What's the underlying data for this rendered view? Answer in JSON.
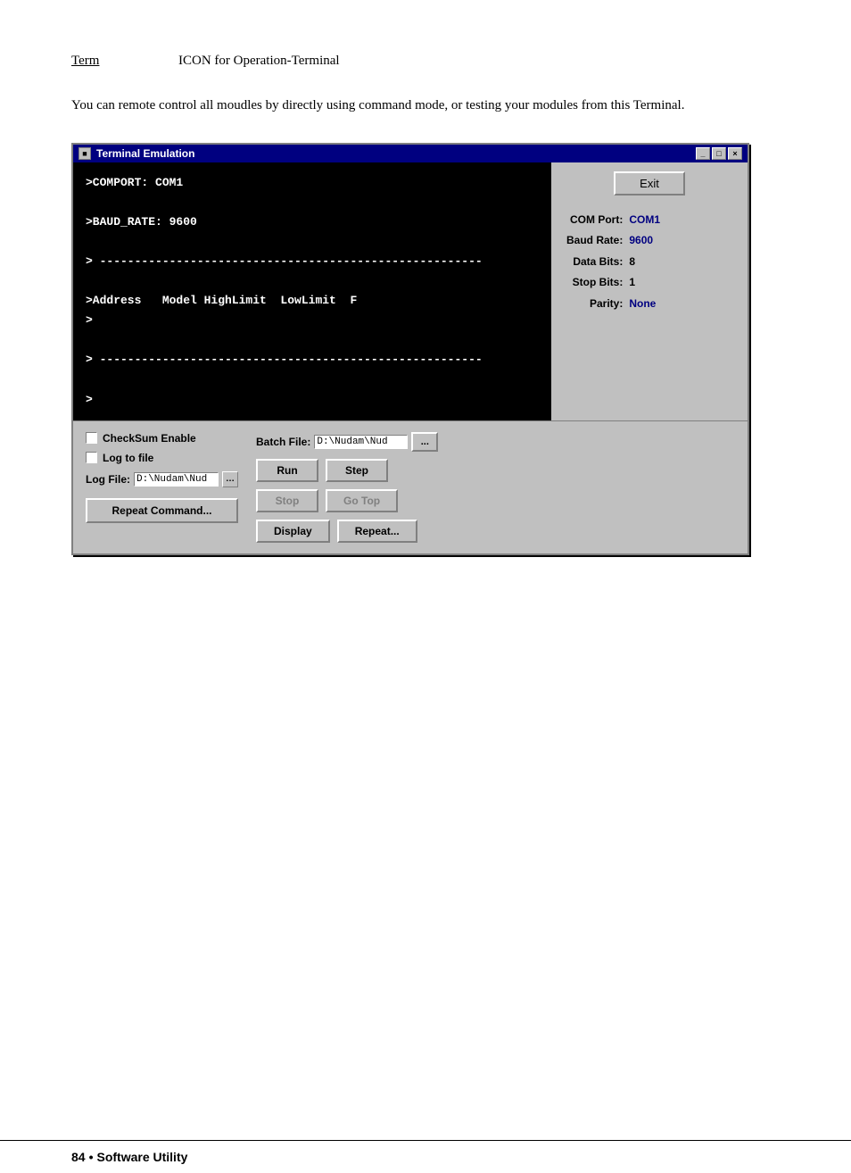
{
  "header": {
    "term_label": "Term",
    "term_description": "ICON for Operation-Terminal"
  },
  "intro": {
    "text": "You can remote control all moudles by directly using command mode, or testing your modules from this Terminal."
  },
  "terminal_window": {
    "title": "Terminal Emulation",
    "title_icon": "■",
    "btn_minimize": "_",
    "btn_restore": "□",
    "btn_close": "×",
    "screen_lines": [
      ">COMPORT: COM1",
      "",
      ">BAUD_RATE: 9600",
      "",
      "> -------------------------------------------------------",
      "",
      ">Address   Model HighLimit  LowLimit  F",
      ">",
      "",
      "> -------------------------------------------------------",
      "",
      ">"
    ],
    "exit_btn": "Exit",
    "com_port_label": "COM Port:",
    "com_port_value": "COM1",
    "baud_rate_label": "Baud Rate:",
    "baud_rate_value": "9600",
    "data_bits_label": "Data Bits:",
    "data_bits_value": "8",
    "stop_bits_label": "Stop Bits:",
    "stop_bits_value": "1",
    "parity_label": "Parity:",
    "parity_value": "None"
  },
  "control_panel": {
    "checksum_label": "CheckSum Enable",
    "log_label": "Log to file",
    "log_file_label": "Log File:",
    "log_file_value": "D:\\Nudam\\Nud",
    "browse_icon": "…",
    "repeat_cmd_btn": "Repeat Command...",
    "batch_file_label": "Batch File:",
    "batch_file_value": "D:\\Nudam\\Nud",
    "batch_browse_icon": "...",
    "run_btn": "Run",
    "step_btn": "Step",
    "stop_btn": "Stop",
    "go_top_btn": "Go Top",
    "display_btn": "Display",
    "repeat_btn": "Repeat..."
  },
  "footer": {
    "page_number": "84",
    "separator": "•",
    "text": "Software Utility"
  }
}
